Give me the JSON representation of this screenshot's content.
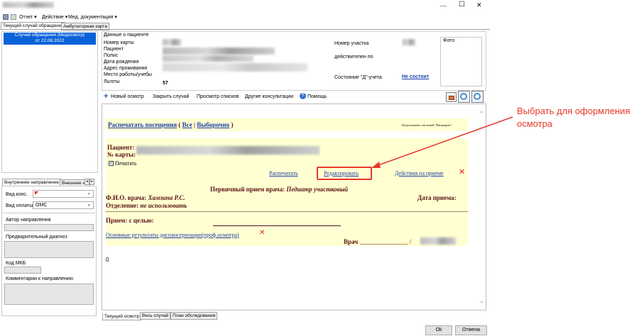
{
  "menu": {
    "report": "Отчет ▾",
    "action": "Действие ▾",
    "meddoc": "Мед. документация ▾"
  },
  "window": {
    "minimize": "—",
    "maximize": "☐",
    "close": "✕"
  },
  "top_tabs": [
    "Текущий случай обращения",
    "Амбулаторная карта"
  ],
  "case_list": {
    "title": "Случай обращения (Медосмотр)",
    "date": "от 22.08.2022"
  },
  "patient": {
    "section_title": "Данные о пациенте",
    "labels": [
      "Номер карты",
      "Пациент",
      "Полис",
      "Дата рождения",
      "Адрес проживания",
      "Место работы/учебы",
      "Льготы"
    ],
    "benefits_value": "57",
    "district_label": "Номер участка",
    "valid_label": "действителен по",
    "d_status_label": "Состояние \"Д\"-учета",
    "d_status_value": "Не состоит",
    "photo_label": "Фото"
  },
  "toolbar": {
    "new_exam": "Новый осмотр",
    "close_case": "Закрыть случай",
    "view_lists": "Просмотр списков",
    "other_consult": "Другие консультации",
    "help": "Помощь"
  },
  "document": {
    "print_visits": "Распечатать посещения",
    "paren_open": "(",
    "all": "Все",
    "sep": "|",
    "selective": "Выборочно",
    "paren_close": ")",
    "prepared_by": "Подготовлено системой \"Витакарта\"",
    "patient_label": "Пациент:",
    "card_label": "№ карты:",
    "print_checkbox": "Печатать",
    "print_link": "Распечатать",
    "edit_link": "Редактировать",
    "actions_link": "Действия на приеме",
    "exam_title_prefix": "Первичный прием врача:",
    "exam_title_value": "Педиатр участковый",
    "doctor_label": "Ф.И.О. врача:",
    "doctor_value": "Хамзина Р.С.",
    "date_label": "Дата приема:",
    "dept_label": "Отделение:",
    "dept_value": "не использовать",
    "reception_label": "Прием: с целью:",
    "results_link": "Основные результаты диспансеризации(проф.осмотра)",
    "doctor_sign": "Врач",
    "doctor_sign_line": "_______________ /",
    "zero": "0"
  },
  "left_panel": {
    "tabs": [
      "Внутреннее направление",
      "Внешнее на"
    ],
    "cons_type_label": "Вид конс.",
    "payment_label": "Вид оплаты",
    "payment_value": "ОМС",
    "author_label": "Автор направления",
    "diag_label": "Предварительный диагноз",
    "mkb_label": "Код МКБ",
    "comments_label": "Комментарии к направлению"
  },
  "bottom_tabs": [
    "Текущий осмотр",
    "Весь случай",
    "План обследования"
  ],
  "buttons": {
    "ok": "Ok",
    "cancel": "Отмена"
  },
  "annotation": {
    "text": "Выбрать для оформления осмотра",
    "color": "#e8392b"
  },
  "colors": {
    "highlight": "#ffffd2",
    "link": "#1e3fa8",
    "doc_text": "#5a1010",
    "accent_red": "#e02424"
  }
}
